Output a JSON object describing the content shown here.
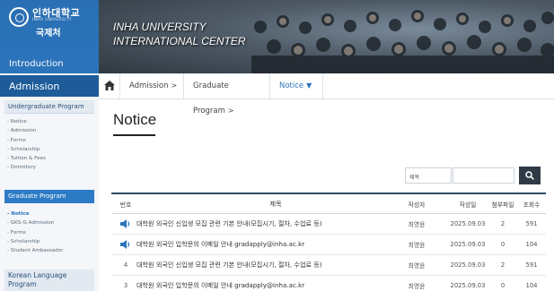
{
  "sidebar": {
    "logo_kr": "인하대학교",
    "logo_en": "INHA UNIVERSITY",
    "logo_dept": "국제처",
    "intro_label": "Introduction",
    "admission_label": "Admission",
    "undergraduate": {
      "header": "Undergraduate Program",
      "items": [
        "- Notice",
        "- Admission",
        "- Forms",
        "- Scholarship",
        "- Tuition & Fees",
        "- Dormitory"
      ]
    },
    "graduate": {
      "header": "Graduate Program",
      "items": [
        "- Notice",
        "- GKS-G Admission",
        "- Forms",
        "- Scholarship",
        "- Student Ambassador"
      ],
      "active_index": 0
    },
    "korean_language": {
      "header_line1": "Korean Language",
      "header_line2": "Program"
    }
  },
  "banner": {
    "line1": "INHA UNIVERSITY",
    "line2": "INTERNATIONAL CENTER"
  },
  "breadcrumb": {
    "items": [
      "Admission",
      "Graduate Program",
      "Notice"
    ]
  },
  "page_title": "Notice",
  "search": {
    "select_value": "제목",
    "input_value": ""
  },
  "table": {
    "headers": {
      "num": "번호",
      "title": "제목",
      "author": "작성자",
      "date": "작성일",
      "files": "첨부파일",
      "views": "조회수"
    },
    "rows": [
      {
        "num": "",
        "notice_icon": "speaker-icon",
        "title": "대학원 외국인 신입생 모집 관련 기본 안내(모집시기, 절차, 수업료 등)",
        "author": "최영윤",
        "date": "2025.09.03",
        "files": "2",
        "views": "591"
      },
      {
        "num": "",
        "notice_icon": "speaker-icon",
        "title": "대학원 외국인 입학문의 이메일 안내 gradapply@inha.ac.kr",
        "author": "최영윤",
        "date": "2025.09.03",
        "files": "0",
        "views": "104"
      },
      {
        "num": "4",
        "title": "대학원 외국인 신입생 모집 관련 기본 안내(모집시기, 절차, 수업료 등)",
        "author": "최영윤",
        "date": "2025.09.03",
        "files": "2",
        "views": "591"
      },
      {
        "num": "3",
        "title": "대학원 외국인 입학문의 이메일 안내 gradapply@inha.ac.kr",
        "author": "최영윤",
        "date": "2025.09.03",
        "files": "0",
        "views": "104"
      }
    ]
  },
  "colors": {
    "primary": "#1d5c99",
    "accent": "#2a74bb",
    "header_bar": "#2e4a67"
  }
}
